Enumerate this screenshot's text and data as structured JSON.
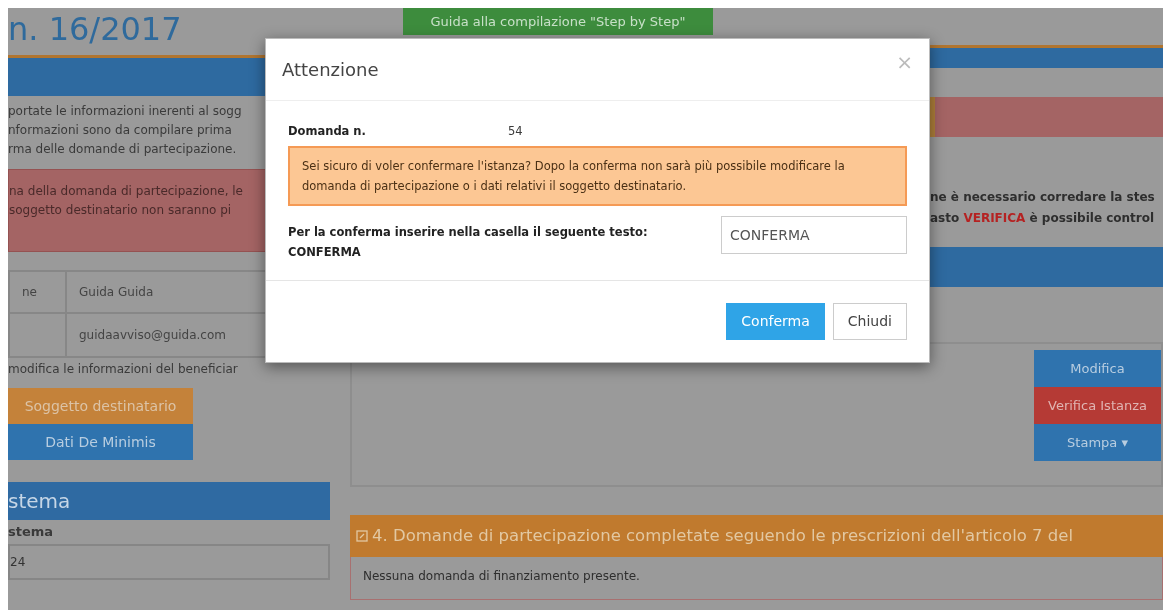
{
  "page": {
    "title": "n. 16/2017",
    "guide_button": "Guida alla compilazione \"Step by Step\""
  },
  "left": {
    "intro_lines": [
      "portate le informazioni inerenti al sogg",
      "nformazioni sono da compilare prima",
      "rma delle domande di partecipazione."
    ],
    "alert_lines": [
      "na della domanda di partecipazione, le",
      "soggetto destinatario non saranno pi"
    ],
    "details": [
      {
        "label": "ne",
        "value": "Guida Guida"
      },
      {
        "value": "guidaavviso@guida.com"
      }
    ],
    "edit_note": "modifica le informazioni del beneficiar",
    "buttons": [
      {
        "label": "Soggetto destinatario",
        "kind": "warning"
      },
      {
        "label": "Dati De Minimis",
        "kind": "primary"
      }
    ],
    "system_panel": {
      "title": "stema",
      "label": "stema",
      "value": "24"
    }
  },
  "right": {
    "instructions": [
      [
        {
          "text": "ne è necessario corredare la stes",
          "emphasis": false
        }
      ],
      [
        {
          "text": "asto ",
          "emphasis": false
        },
        {
          "text": "VERIFICA",
          "emphasis": true
        },
        {
          "text": " è possibile control",
          "emphasis": false
        }
      ]
    ],
    "actions": [
      {
        "label": "Modifica",
        "kind": "primary"
      },
      {
        "label": "Verifica Istanza",
        "kind": "danger"
      },
      {
        "label": "Stampa",
        "kind": "primary",
        "caret": "▾"
      }
    ],
    "section4": {
      "title": "4. Domande di partecipazione completate seguendo le prescrizioni dell'articolo 7 del",
      "empty_text": "Nessuna domanda di finanziamento presente."
    }
  },
  "modal": {
    "title": "Attenzione",
    "close": "×",
    "fields": [
      {
        "label": "Domanda n.",
        "value": "54"
      }
    ],
    "warning": "Sei sicuro di voler confermare l'istanza? Dopo la conferma non sarà più possibile modificare la domanda di partecipazione o i dati relativi il soggetto destinatario.",
    "confirm_label": "Per la conferma inserire nella casella il seguente testo:",
    "confirm_word": "CONFERMA",
    "input_value": "CONFERMA",
    "buttons": [
      {
        "label": "Conferma",
        "kind": "primary"
      },
      {
        "label": "Chiudi",
        "kind": "default"
      }
    ]
  }
}
